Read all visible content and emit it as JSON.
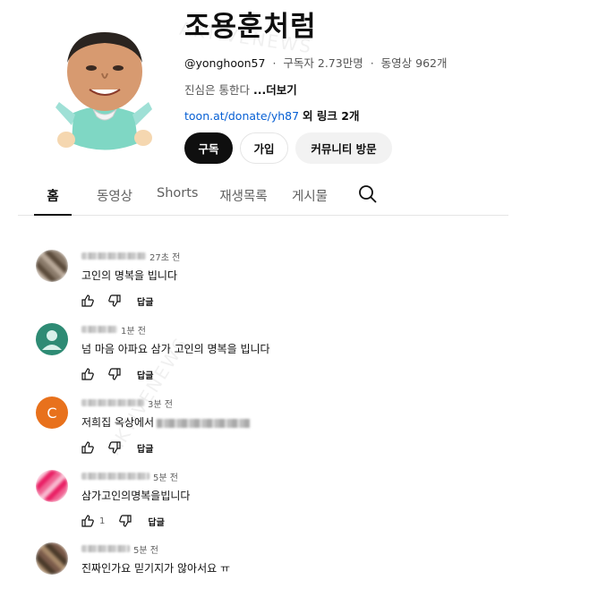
{
  "channel": {
    "name": "조용훈처럼",
    "handle": "@yonghoon57",
    "subscribers": "구독자 2.73만명",
    "videos": "동영상 962개",
    "tagline": "진심은 통한다",
    "more_label": "...더보기",
    "link_url": "toon.at/donate/yh87",
    "link_extra": "외 링크 2개",
    "separator": "·"
  },
  "buttons": {
    "subscribe": "구독",
    "join": "가입",
    "community": "커뮤니티 방문"
  },
  "tabs": [
    {
      "label": "홈",
      "active": true
    },
    {
      "label": "동영상",
      "active": false
    },
    {
      "label": "Shorts",
      "active": false
    },
    {
      "label": "재생목록",
      "active": false
    },
    {
      "label": "게시물",
      "active": false
    }
  ],
  "comments": [
    {
      "time": "27초 전",
      "text": "고인의 명복을 빕니다",
      "likes": "",
      "reply": "답글",
      "avatar_color": "#8a7a6a"
    },
    {
      "time": "1분 전",
      "text": "넘 마음 아파요 삼가 고인의 명복을 빕니다",
      "likes": "",
      "reply": "답글",
      "avatar_color": "#3a8c7a"
    },
    {
      "time": "3분 전",
      "text": "저희집 옥상에서",
      "likes": "",
      "reply": "답글",
      "avatar_color": "#e8711c",
      "avatar_letter": "C"
    },
    {
      "time": "5분 전",
      "text": "삼가고인의명복을빕니다",
      "likes": "1",
      "reply": "답글",
      "avatar_color": "#e05a8a"
    },
    {
      "time": "5분 전",
      "text": "진짜인가요 믿기지가 않아서요 ㅠ",
      "likes": "",
      "reply": "답글",
      "avatar_color": "#7a5a4a"
    }
  ],
  "watermark": "AKTIVENEWS"
}
